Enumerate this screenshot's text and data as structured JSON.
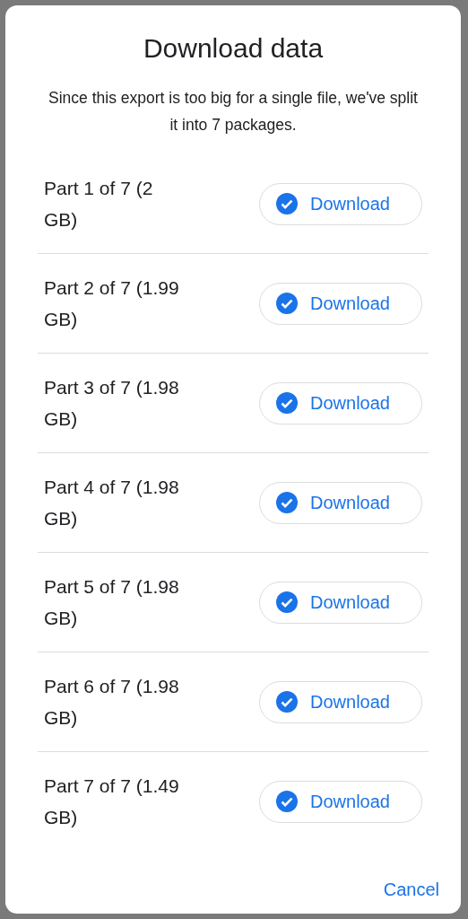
{
  "dialog": {
    "title": "Download data",
    "message": "Since this export is too big for a single file, we've split it into 7 packages.",
    "parts": [
      {
        "label": "Part 1 of 7 (2 GB)",
        "button": "Download",
        "downloaded": true
      },
      {
        "label": "Part 2 of 7 (1.99 GB)",
        "button": "Download",
        "downloaded": true
      },
      {
        "label": "Part 3 of 7 (1.98 GB)",
        "button": "Download",
        "downloaded": true
      },
      {
        "label": "Part 4 of 7 (1.98 GB)",
        "button": "Download",
        "downloaded": true
      },
      {
        "label": "Part 5 of 7 (1.98 GB)",
        "button": "Download",
        "downloaded": true
      },
      {
        "label": "Part 6 of 7 (1.98 GB)",
        "button": "Download",
        "downloaded": true
      },
      {
        "label": "Part 7 of 7 (1.49 GB)",
        "button": "Download",
        "downloaded": true
      }
    ],
    "cancel": "Cancel"
  }
}
